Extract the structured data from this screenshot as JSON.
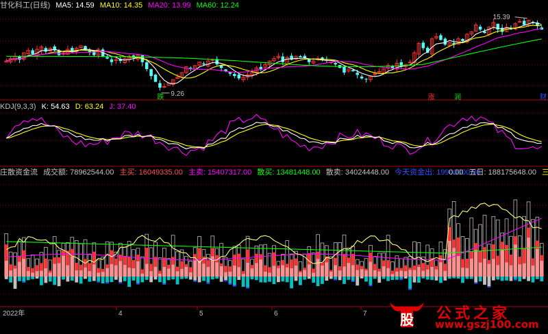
{
  "colors": {
    "background": "#000000",
    "up": "#ff3232",
    "down": "#54ffff",
    "ma5": "#ffffff",
    "ma10": "#ffff00",
    "ma20": "#ff00ff",
    "ma60": "#00ff00",
    "grid": "#800000",
    "axis": "#b00000",
    "text": "#c0c0c0",
    "vol_up": "#ff3030",
    "vol_up_light": "#ff9090",
    "vol_down": "#00c0c0",
    "vol_outline": "#c0c0c0",
    "vol_blue": "#3050ff"
  },
  "price_header": {
    "name": "甘化科工(日线)",
    "ma5": "MA5: 14.59",
    "ma10": "MA10: 14.35",
    "ma20": "MA20: 13.99",
    "ma60": "MA60: 12.24"
  },
  "kdj_header": {
    "name": "KDJ(9,3,3)",
    "k": "K: 54.63",
    "d": "D: 63.24",
    "j": "J: 37.40"
  },
  "fund_header": {
    "name": "庄散资金流",
    "turnover": "成交额: 78962544.00",
    "main_buy": "主买: 16049335.00",
    "main_sell": "主卖: 15407317.00",
    "retail_buy": "散买: 13481448.00",
    "retail_sell": "散卖: 34024448.00",
    "hot_money": "今天资金出: 19900000.00",
    "five_day": "五日: 188175648.00",
    "dots": "0.00",
    "three_five": "三五日"
  },
  "annotations": {
    "high_label": "15.39",
    "low_label": "9.26",
    "sig_die": "跌",
    "sig_zhang": "涨",
    "sig_run": "润",
    "sig_cai": "财"
  },
  "x_axis": {
    "year": "2022年",
    "months": [
      "4",
      "5",
      "6",
      "7"
    ]
  },
  "watermark": {
    "logo_char": "股",
    "title": "公式之家",
    "url": "www.gszj100.com"
  },
  "chart_data": [
    {
      "type": "candlestick",
      "title": "甘化科工(日线)",
      "indicators": [
        "MA5",
        "MA10",
        "MA20",
        "MA60"
      ],
      "last_values": {
        "MA5": 14.59,
        "MA10": 14.35,
        "MA20": 13.99,
        "MA60": 12.24
      },
      "high": 15.39,
      "low": 9.26,
      "ylim": [
        8.9,
        16.2
      ],
      "close": [
        11.9,
        12.1,
        12.3,
        12.0,
        12.6,
        12.8,
        12.5,
        12.9,
        13.1,
        12.7,
        13.0,
        12.8,
        12.4,
        12.6,
        12.9,
        12.7,
        13.0,
        13.2,
        12.8,
        12.6,
        12.4,
        12.9,
        12.3,
        12.1,
        11.8,
        12.0,
        11.9,
        12.1,
        12.3,
        12.2,
        12.4,
        11.8,
        11.2,
        10.6,
        10.1,
        9.6,
        9.7,
        10.0,
        10.3,
        10.5,
        10.9,
        11.4,
        11.3,
        11.5,
        11.8,
        11.6,
        11.9,
        12.0,
        11.6,
        11.3,
        11.0,
        10.8,
        10.6,
        10.4,
        10.5,
        10.7,
        10.9,
        11.3,
        11.2,
        11.6,
        11.9,
        12.1,
        12.3,
        11.8,
        12.2,
        12.0,
        12.3,
        12.2,
        12.1,
        11.8,
        11.9,
        12.1,
        12.0,
        11.9,
        11.8,
        11.6,
        11.3,
        10.9,
        11.2,
        11.0,
        10.7,
        10.4,
        10.3,
        10.6,
        10.8,
        11.0,
        11.2,
        11.5,
        11.3,
        11.7,
        11.4,
        11.6,
        11.8,
        12.6,
        13.4,
        13.0,
        12.6,
        13.8,
        14.0,
        13.7,
        13.3,
        13.5,
        13.3,
        13.8,
        13.6,
        14.2,
        14.4,
        15.0,
        14.6,
        14.3,
        14.8,
        15.2,
        14.6,
        14.4,
        14.8,
        14.6,
        15.1,
        15.3,
        15.0,
        15.4,
        15.2,
        14.9,
        14.6
      ]
    },
    {
      "type": "line",
      "title": "KDJ(9,3,3)",
      "series": [
        {
          "name": "K",
          "last": 54.63
        },
        {
          "name": "D",
          "last": 63.24
        },
        {
          "name": "J",
          "last": 37.4
        }
      ],
      "ylim": [
        -20,
        120
      ]
    },
    {
      "type": "bar",
      "title": "庄散资金流",
      "series": [
        {
          "name": "主买",
          "last": 16049335.0
        },
        {
          "name": "主卖",
          "last": 15407317.0
        },
        {
          "name": "散买",
          "last": 13481448.0
        },
        {
          "name": "散卖",
          "last": 34024448.0
        }
      ],
      "turnover": 78962544.0,
      "five_day": 188175648.0
    }
  ]
}
